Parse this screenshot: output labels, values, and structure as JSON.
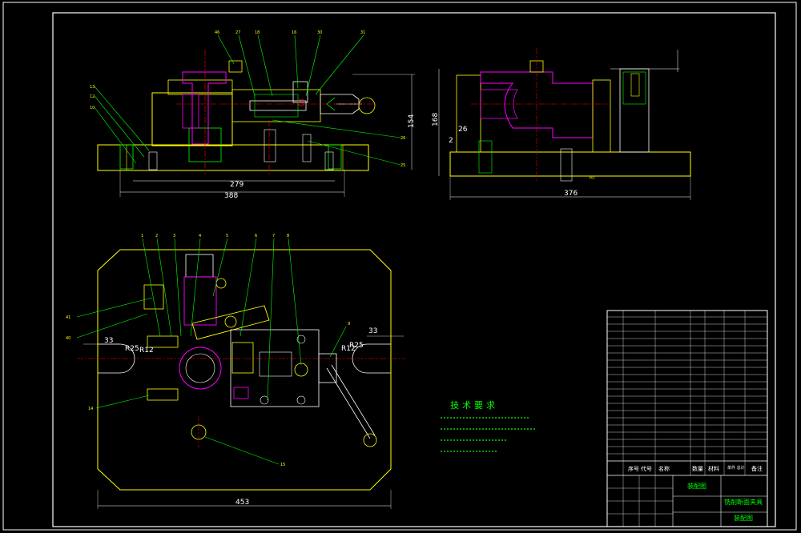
{
  "front_view": {
    "dims": [
      "279",
      "388",
      "154"
    ],
    "tags_top": [
      "46",
      "27",
      "18",
      "16",
      "30",
      "31"
    ],
    "tags_left": [
      "13",
      "12",
      "10"
    ],
    "tags_right": [
      "26",
      "25"
    ]
  },
  "side_view": {
    "dims": [
      "168",
      "376",
      "26",
      "2",
      "H7"
    ]
  },
  "plan_view": {
    "dims": [
      "453",
      "33",
      "33",
      "R25",
      "R12",
      "R12",
      "R25"
    ],
    "tags_top": [
      "1",
      "2",
      "3",
      "4",
      "5",
      "6",
      "7",
      "8"
    ],
    "tags_left": [
      "41",
      "40",
      "14"
    ],
    "tags_right": [
      "9"
    ],
    "tags_bottom": [
      "15"
    ]
  },
  "technical_requirements": {
    "title": "技术要求"
  },
  "title_block": {
    "drawing_type": "装配图",
    "part_name": "铣削断面夹具",
    "drawing_name": "装配图",
    "col_no": "序号",
    "col_code": "代号",
    "col_name": "名称",
    "col_qty": "数量",
    "col_material": "材料",
    "col_unit_total": "单件 总计",
    "col_note": "备注"
  }
}
